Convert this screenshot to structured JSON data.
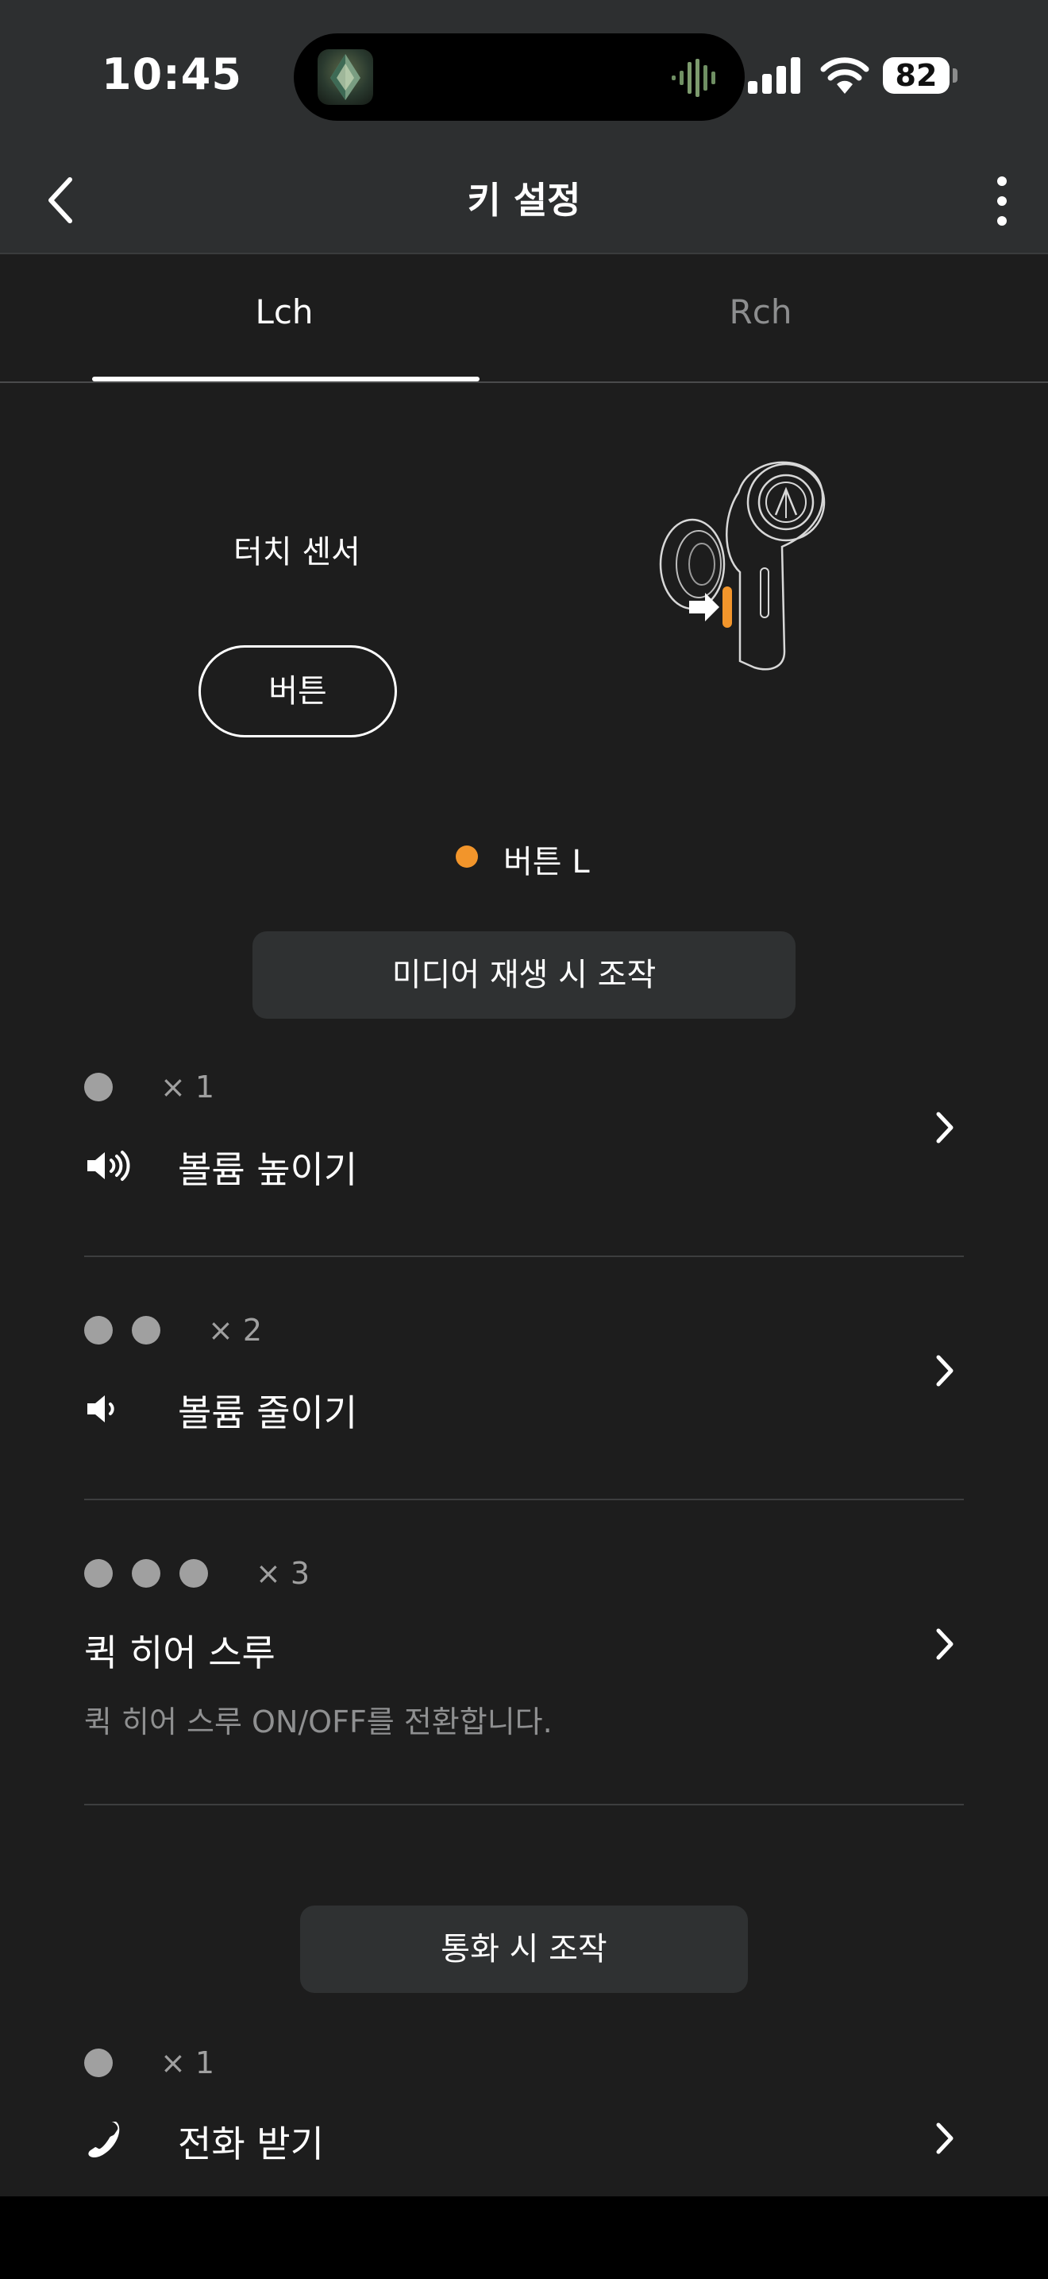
{
  "status_bar": {
    "time": "10:45",
    "battery": "82"
  },
  "nav": {
    "title": "키 설정"
  },
  "tabs": [
    {
      "label": "Lch",
      "selected": true
    },
    {
      "label": "Rch",
      "selected": false
    }
  ],
  "control": {
    "touch_sensor_label": "터치 센서",
    "button_label": "버튼",
    "legend_label": "버튼 L",
    "legend_color": "#f2952b"
  },
  "media_section": {
    "title": "미디어 재생 시 조작",
    "rows": [
      {
        "taps": "× 1",
        "label": "볼륨 높이기",
        "icon": "volume-up-icon"
      },
      {
        "taps": "× 2",
        "label": "볼륨 줄이기",
        "icon": "volume-down-icon"
      },
      {
        "taps": "× 3",
        "label": "퀵 히어 스루",
        "description": "퀵 히어 스루 ON/OFF를 전환합니다."
      }
    ]
  },
  "call_section": {
    "title": "통화 시 조작",
    "rows": [
      {
        "taps": "× 1",
        "label": "전화 받기",
        "icon": "phone-icon"
      }
    ]
  }
}
